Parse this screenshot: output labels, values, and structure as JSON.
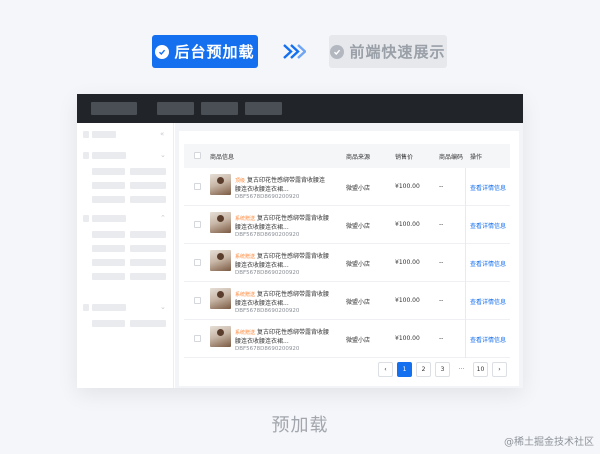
{
  "steps": {
    "active_label": "后台预加载",
    "inactive_label": "前端快速展示"
  },
  "colors": {
    "accent": "#1570ef",
    "tag": "#ff8a3d",
    "topbar": "#21252a"
  },
  "table": {
    "headers": {
      "product_info": "商品信息",
      "source": "商品来源",
      "price": "销售价",
      "code": "商品编码",
      "operation": "操作"
    },
    "rows": [
      {
        "tag": "顶级",
        "title_1": "复古印花性感绑带露背收腰",
        "title_2": "连",
        "title_3": "腰连衣收腰连衣裙...",
        "code": "DBF5678D8690200920",
        "source": "微盟小店",
        "price": "¥100.00",
        "code_col": "--",
        "action": "查看详情信息"
      },
      {
        "tag": "系统赠送",
        "title_1": "复古印花性感绑带露背收腰",
        "title_2": "",
        "title_3": "腰连衣收腰连衣裙...",
        "code": "DBF5678D8690200920",
        "source": "微盟小店",
        "price": "¥100.00",
        "code_col": "--",
        "action": "查看详情信息"
      },
      {
        "tag": "系统赠送",
        "title_1": "复古印花性感绑带露背收腰",
        "title_2": "",
        "title_3": "腰连衣收腰连衣裙...",
        "code": "DBF5678D8690200920",
        "source": "微盟小店",
        "price": "¥100.00",
        "code_col": "--",
        "action": "查看详情信息"
      },
      {
        "tag": "系统赠送",
        "title_1": "复古印花性感绑带露背收腰",
        "title_2": "",
        "title_3": "腰连衣收腰连衣裙...",
        "code": "DBF5678D8690200920",
        "source": "微盟小店",
        "price": "¥100.00",
        "code_col": "--",
        "action": "查看详情信息"
      },
      {
        "tag": "系统赠送",
        "title_1": "复古印花性感绑带露背收腰",
        "title_2": "",
        "title_3": "腰连衣收腰连衣裙...",
        "code": "DBF5678D8690200920",
        "source": "微盟小店",
        "price": "¥100.00",
        "code_col": "--",
        "action": "查看详情信息"
      }
    ]
  },
  "pagination": {
    "prev": "‹",
    "pages": [
      "1",
      "2",
      "3"
    ],
    "ellipsis": "···",
    "last": "10",
    "next": "›",
    "current": "1"
  },
  "caption": "预加载",
  "watermark": "@稀土掘金技术社区"
}
